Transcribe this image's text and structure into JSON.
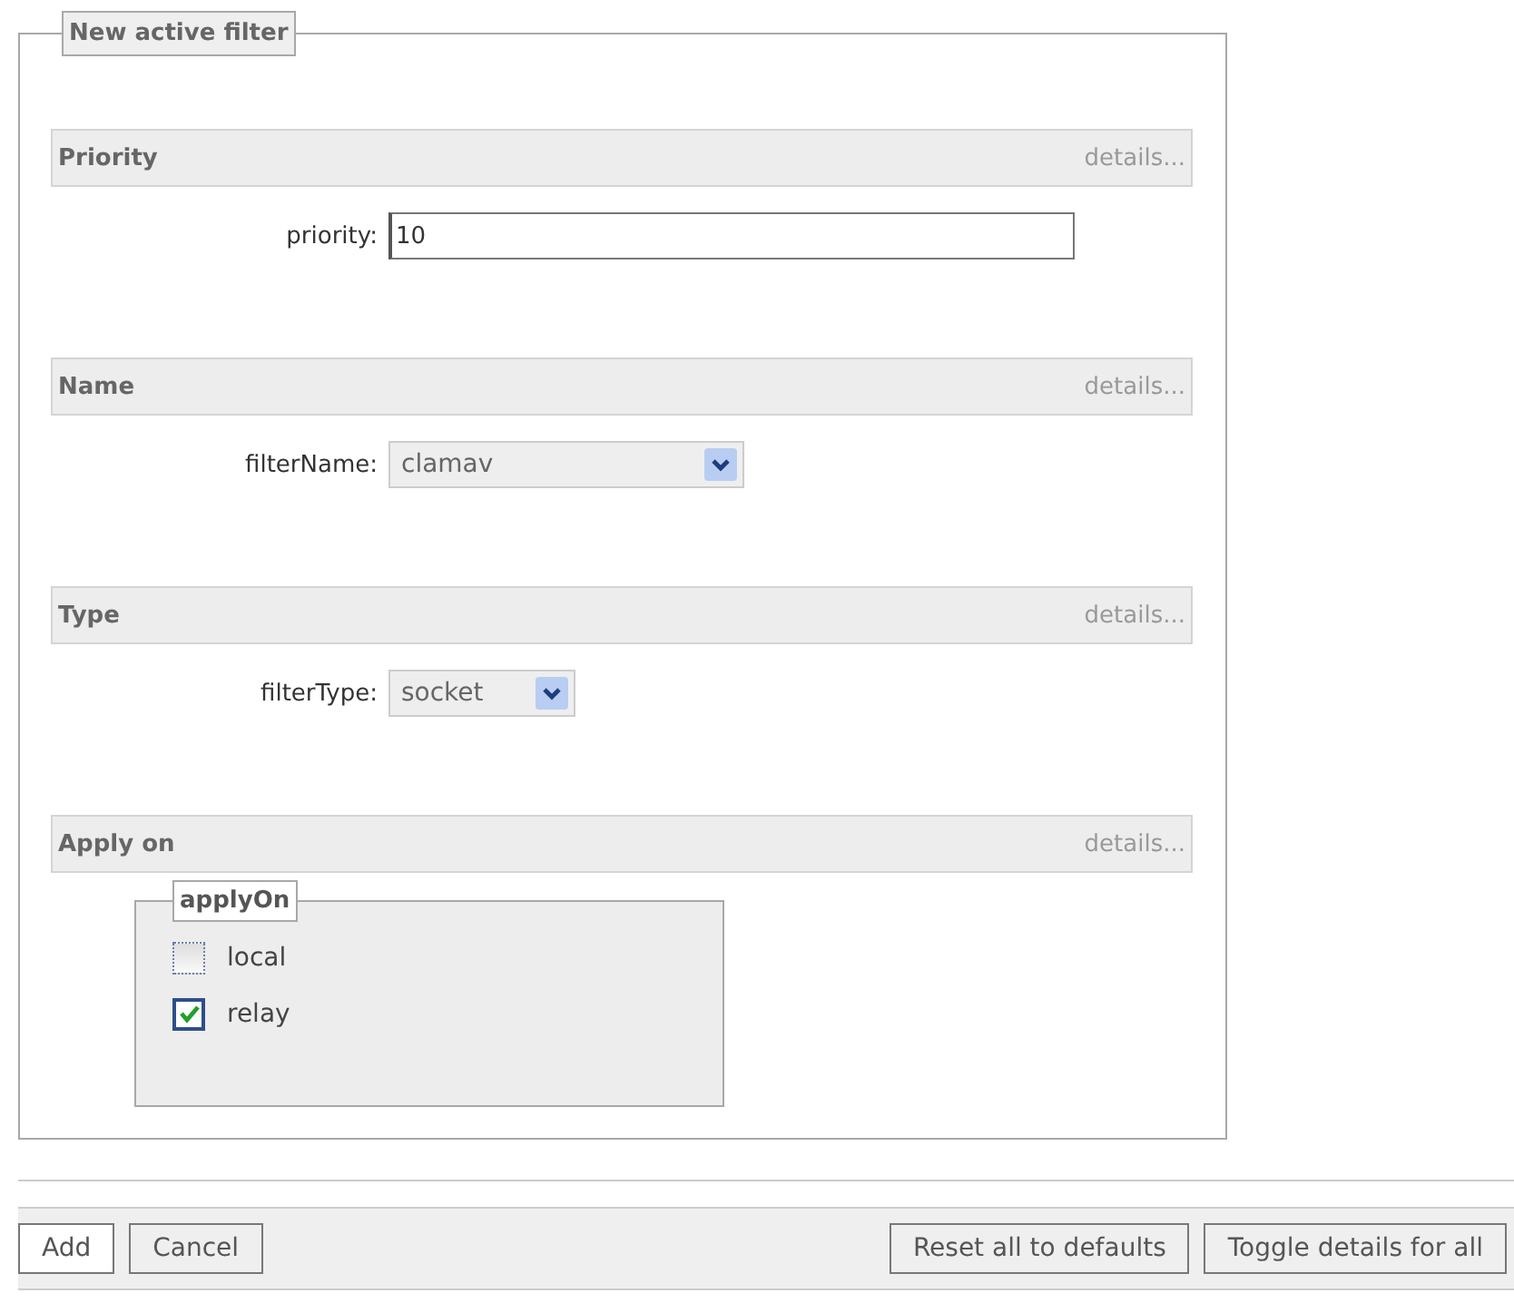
{
  "form": {
    "legend": "New active filter",
    "sections": [
      {
        "title": "Priority",
        "details": "details...",
        "kind": "text",
        "label": "priority:",
        "value": "10"
      },
      {
        "title": "Name",
        "details": "details...",
        "kind": "select",
        "label": "filterName:",
        "value": "clamav"
      },
      {
        "title": "Type",
        "details": "details...",
        "kind": "select",
        "label": "filterType:",
        "value": "socket"
      },
      {
        "title": "Apply on",
        "details": "details...",
        "kind": "checkgroup",
        "legend": "applyOn",
        "options": [
          {
            "label": "local",
            "checked": false
          },
          {
            "label": "relay",
            "checked": true
          }
        ]
      }
    ]
  },
  "buttons": {
    "left": [
      "Add",
      "Cancel"
    ],
    "right": [
      "Reset all to defaults",
      "Toggle details for all"
    ]
  }
}
